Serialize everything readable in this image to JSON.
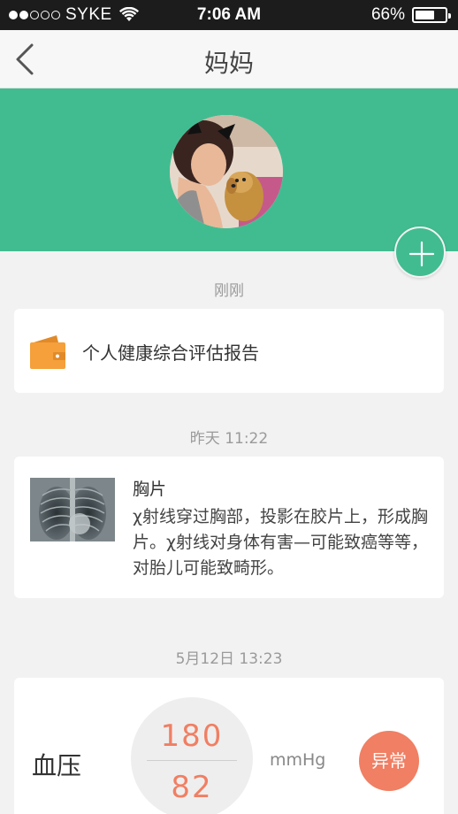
{
  "status_bar": {
    "carrier": "SYKE",
    "time": "7:06 AM",
    "battery": "66%",
    "battery_level": 0.66
  },
  "nav": {
    "title": "妈妈"
  },
  "timeline": [
    {
      "timestamp": "刚刚",
      "title": "个人健康综合评估报告",
      "icon": "wallet-icon"
    },
    {
      "timestamp": "昨天 11:22",
      "title": "胸片",
      "description": "χ射线穿过胸部，投影在胶片上，形成胸片。χ射线对身体有害—可能致癌等等，对胎儿可能致畸形。"
    },
    {
      "timestamp": "5月12日 13:23",
      "label": "血压",
      "systolic": "180",
      "diastolic": "82",
      "unit": "mmHg",
      "status": "异常"
    }
  ],
  "colors": {
    "accent": "#41bc91",
    "alert": "#f07f63",
    "wallet": "#f5a03a"
  }
}
